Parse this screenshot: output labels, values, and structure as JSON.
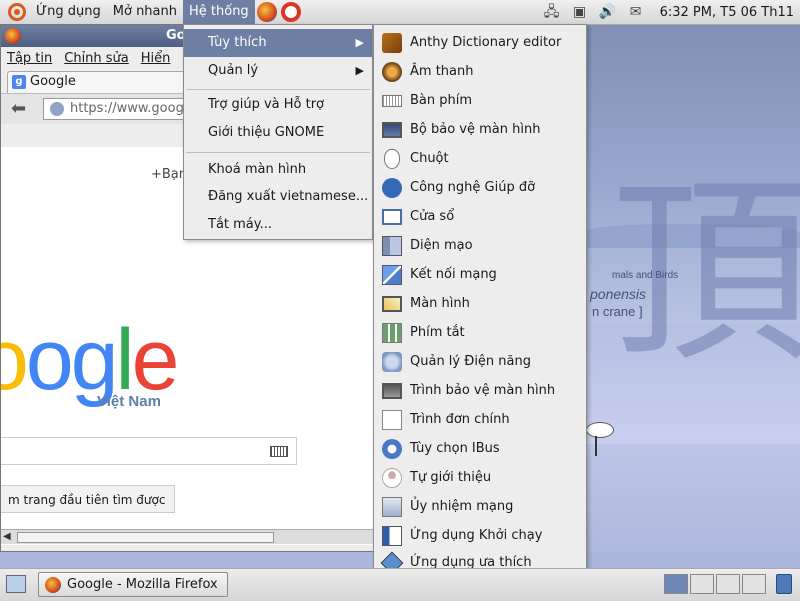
{
  "top_panel": {
    "menus": [
      "Ứng dụng",
      "Mở nhanh",
      "Hệ thống"
    ],
    "clock": "6:32 PM, T5 06 Th11",
    "tray_icons": [
      "network-icon",
      "display-icon",
      "volume-icon",
      "mail-icon"
    ]
  },
  "firefox": {
    "title_fragment": "Go",
    "menubar": [
      "Tập tin",
      "Chỉnh sửa",
      "Hiển"
    ],
    "tab_title": "Google",
    "url": "https://www.goog",
    "content": {
      "plus_link": "+Bạn",
      "logo_text": "oogle",
      "region": "Việt Nam",
      "button": "m trang đầu tiên tìm được"
    }
  },
  "system_menu": {
    "items": [
      {
        "label": "Tùy thích",
        "has_submenu": true
      },
      {
        "label": "Quản lý",
        "has_submenu": true
      },
      {
        "label": "Trợ giúp và Hỗ trợ"
      },
      {
        "label": "Giới thiệu GNOME"
      },
      {
        "label": "Khoá màn hình"
      },
      {
        "label": "Đăng xuất vietnamese..."
      },
      {
        "label": "Tắt máy..."
      }
    ]
  },
  "preferences_menu": {
    "items": [
      {
        "label": "Anthy Dictionary editor",
        "icon": "book-icon"
      },
      {
        "label": "Âm thanh",
        "icon": "speaker-icon"
      },
      {
        "label": "Bàn phím",
        "icon": "keyboard-icon"
      },
      {
        "label": "Bộ bảo vệ màn hình",
        "icon": "monitor-icon"
      },
      {
        "label": "Chuột",
        "icon": "mouse-icon"
      },
      {
        "label": "Công nghệ Giúp đỡ",
        "icon": "accessibility-icon"
      },
      {
        "label": "Cửa sổ",
        "icon": "window-icon"
      },
      {
        "label": "Diện mạo",
        "icon": "appearance-icon"
      },
      {
        "label": "Kết nối mạng",
        "icon": "network-connections-icon"
      },
      {
        "label": "Màn hình",
        "icon": "display-icon"
      },
      {
        "label": "Phím tắt",
        "icon": "shortcuts-icon"
      },
      {
        "label": "Quản lý Điện năng",
        "icon": "power-icon"
      },
      {
        "label": "Trình bảo vệ màn hình",
        "icon": "screensaver-icon"
      },
      {
        "label": "Trình đơn chính",
        "icon": "main-menu-icon"
      },
      {
        "label": "Tùy chọn IBus",
        "icon": "ibus-icon"
      },
      {
        "label": "Tự giới thiệu",
        "icon": "about-me-icon"
      },
      {
        "label": "Ủy nhiệm mạng",
        "icon": "proxy-icon"
      },
      {
        "label": "Ứng dụng Khởi chạy",
        "icon": "startup-icon"
      },
      {
        "label": "Ứng dụng ưa thích",
        "icon": "preferred-apps-icon"
      }
    ]
  },
  "wallpaper": {
    "kanji": "頂",
    "caption_small": "mals and Birds",
    "caption_latin": "ponensis",
    "caption_common": "n crane ]"
  },
  "bottom_panel": {
    "task": "Google - Mozilla Firefox",
    "workspaces": 4,
    "active_workspace": 1
  },
  "colors": {
    "highlight": "#6d7fa3",
    "menu_bg": "#ededed"
  }
}
